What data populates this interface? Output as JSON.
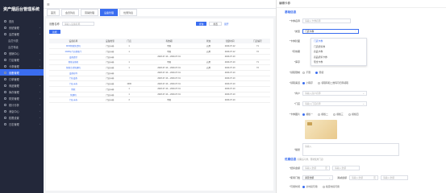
{
  "sidebar": {
    "brand": "资产烟后台管理系统",
    "items": [
      {
        "label": "首页",
        "type": "main"
      },
      {
        "label": "系统管理",
        "type": "main"
      },
      {
        "label": "会员管理",
        "type": "main"
      },
      {
        "label": "会员列表",
        "type": "sub"
      },
      {
        "label": "会员等级",
        "type": "sub"
      },
      {
        "label": "营销中心",
        "type": "main"
      },
      {
        "label": "门店管理",
        "type": "main"
      },
      {
        "label": "卡券管理",
        "type": "main"
      },
      {
        "label": "设备管理",
        "type": "main"
      },
      {
        "label": "订单管理",
        "type": "main"
      },
      {
        "label": "商品管理",
        "type": "main"
      },
      {
        "label": "库存管理",
        "type": "main"
      },
      {
        "label": "财务管理",
        "type": "main"
      },
      {
        "label": "统计分析",
        "type": "main"
      },
      {
        "label": "消息中心",
        "type": "main"
      },
      {
        "label": "权限设置",
        "type": "main"
      },
      {
        "label": "日志管理",
        "type": "main"
      }
    ],
    "active_index": 8
  },
  "topbar": {
    "menu_icon": "menu-icon"
  },
  "tabs": [
    "首页",
    "会员列表",
    "营销管理",
    "设备管理",
    "优惠列表"
  ],
  "active_tab": 3,
  "filter": {
    "label": "设备名称",
    "placeholder": "请输入设备名称",
    "search": "查询",
    "reset": "重置",
    "more": "展开"
  },
  "add_button": "新增",
  "table": {
    "headers": [
      "设备名称",
      "设备类型",
      "门店",
      "有效期",
      "状态",
      "创建时间",
      "门店编号"
    ],
    "rows": [
      [
        "MINI智能售货机",
        "门店卡券",
        "1",
        "不限",
        "启用",
        "2020-07-12",
        "Y1"
      ],
      [
        "2020年门店智能门",
        "门店卡券",
        "1",
        "不限",
        "启用",
        "2020-07-12",
        "Y2"
      ],
      [
        "设备类型",
        "门店卡券",
        "",
        "2020-07-10 ~ 2020-07-31",
        "",
        "2020-07-10",
        ""
      ],
      [
        "智能自助机",
        "门店卡券",
        "1",
        "不限",
        "启用",
        "2020-07-10",
        "Y1"
      ],
      [
        "智能立式售烟机",
        "门店卡券",
        "1",
        "2020-07-10 ~ 2020-07-31",
        "启用",
        "2020-07-10",
        "Y2"
      ],
      [
        "设备名称",
        "门店卡券",
        "",
        "2020-07-10 ~ 2020-07-31",
        "",
        "2020-07-10",
        ""
      ],
      [
        "门店设备",
        "门店卡券",
        "",
        "2020-07-10 ~ 2020-07-31",
        "",
        "2020-07-10",
        ""
      ],
      [
        "门店卡券",
        "门店卡券",
        "1000",
        "2020-07-10 ~ 2020-07-31",
        "",
        "2020-07-10",
        ""
      ],
      [
        "智能",
        "门店卡券",
        "1",
        "2020-07-10 ~ 2020-07-31",
        "",
        "2020-07-10",
        ""
      ],
      [
        "售烟机",
        "门店卡券",
        "1",
        "2020-07-10 ~ 2020-07-31",
        "",
        "2020-07-10",
        ""
      ],
      [
        "门店卡券",
        "门店卡券",
        "3",
        "不限",
        "",
        "2020-07-10",
        ""
      ]
    ]
  },
  "panel": {
    "title": "编辑卡券",
    "section1": "基础信息",
    "section2": "优惠信息",
    "section2_note": "(领取后可用，限制使用门店)",
    "fields": {
      "name_label": "*卡券名称",
      "name_placeholder": "请输入卡券名称",
      "type_label": "*类型",
      "type_value": "门店卡券",
      "cover_label": "*卡券封面",
      "validity_label": "*有效期",
      "stock_label": "*库存",
      "limit_label": "*领取限制",
      "channel_label": "*领取渠道",
      "merchant_label": "*商户",
      "store_label": "*门店",
      "image_label": "*卡券图片",
      "desc_label": "*描述",
      "desc_placeholder": "请输入",
      "discount_label": "*抵扣金额",
      "threshold_label": "*使用门槛",
      "usable_label": "*可用时间"
    },
    "dropdown": [
      "门店卡券",
      "门店折扣券",
      "商品卡券",
      "商品折扣卡券",
      "现金卡券"
    ],
    "dropdown_selected": 0,
    "channel_options": [
      "小程序",
      "领取码和二维码可扫码领取"
    ],
    "limit_options": [
      "不限",
      "限领"
    ],
    "merchant_placeholder": "请输入商户名称",
    "store_placeholder": "请输入门店名称",
    "image_options": [
      "模板一",
      "模板二",
      "模板三",
      "模板四"
    ],
    "discount_placeholder": "请输入金额",
    "threshold_select": "满足金额",
    "threshold_placeholder": "请输入金额",
    "threshold_unit": "元",
    "threshold_discount_label": "满减金额",
    "usable_options": [
      "全时段可用",
      "指定时段可用"
    ],
    "unit_yuan": "元",
    "unit_ge": "个"
  }
}
